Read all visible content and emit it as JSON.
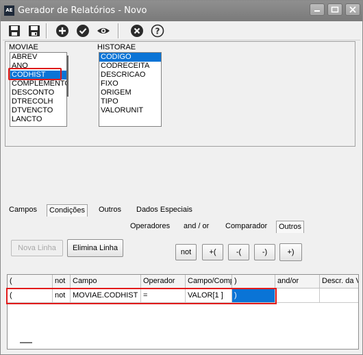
{
  "app": {
    "icon_label": "AE",
    "title": "Gerador de Relatórios - Novo"
  },
  "toolbar": {
    "icons": [
      "save-icon",
      "save-as-icon",
      "add-icon",
      "check-icon",
      "preview-eye-icon",
      "cancel-icon",
      "help-icon"
    ]
  },
  "moviae": {
    "title": "MOVIAE",
    "items": [
      "ABREV",
      "ANO",
      "CODHIST",
      "COMPLEMENTO",
      "DESCONTO",
      "DTRECOLH",
      "DTVENCTO",
      "LANCTO"
    ],
    "selected": "CODHIST"
  },
  "historae": {
    "title": "HISTORAE",
    "items": [
      "CODIGO",
      "CODRECEITA",
      "DESCRICAO",
      "FIXO",
      "ORIGEM",
      "TIPO",
      "VALORUNIT"
    ],
    "selected": "CODIGO"
  },
  "tabs": [
    "Campos",
    "Condições",
    "Outros",
    "Dados Especiais"
  ],
  "active_tab": "Condições",
  "subtabs": [
    "Operadores",
    "and / or",
    "Comparador",
    "Outros"
  ],
  "active_subtab": "Outros",
  "buttons": {
    "new_line": "Nova Linha",
    "delete_line": "Elimina Linha",
    "ops": [
      "not",
      "+(",
      "-(",
      "-)",
      "+)"
    ]
  },
  "grid": {
    "columns": [
      "(",
      "not",
      "Campo",
      "Operador",
      "Campo/Comp",
      ")",
      "and/or",
      "Descr. da V"
    ],
    "rows": [
      [
        "(",
        "not",
        "MOVIAE.CODHIST",
        "=",
        "VALOR[1 ]",
        ")",
        "",
        ""
      ]
    ]
  },
  "colors": {
    "selection": "#0a74d6",
    "highlight": "#e21a1a",
    "titlebar": "#848484"
  }
}
